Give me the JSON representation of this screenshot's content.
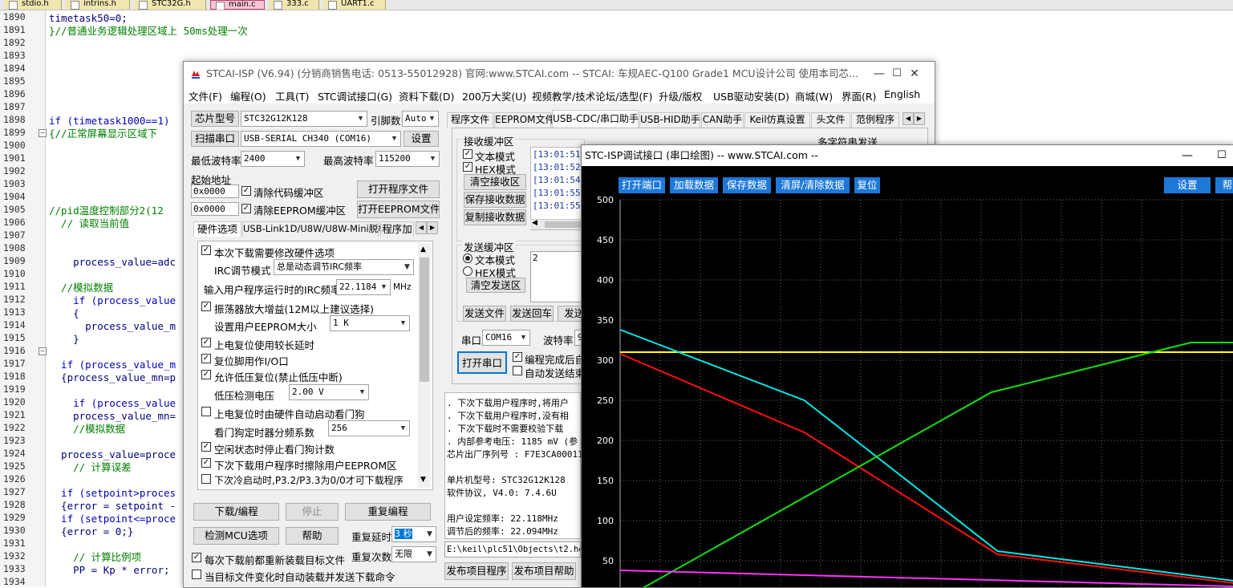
{
  "editor_tabs": [
    {
      "label": "stdio.h",
      "active": false
    },
    {
      "label": "intrins.h",
      "active": false
    },
    {
      "label": "STC32G.h",
      "active": false
    },
    {
      "label": "main.c",
      "active": true
    },
    {
      "label": "333.c",
      "active": false
    },
    {
      "label": "UART1.c",
      "active": false
    }
  ],
  "code": {
    "line_numbers": [
      "1890",
      "1891",
      "1892",
      "1893",
      "1894",
      "1895",
      "1896",
      "1897",
      "1898",
      "1899",
      "1900",
      "1901",
      "1902",
      "1903",
      "1904",
      "1905",
      "1906",
      "1907",
      "1908",
      "1909",
      "1910",
      "1911",
      "1912",
      "1913",
      "1914",
      "1915",
      "1916",
      "1917",
      "1918",
      "1919",
      "1920",
      "1921",
      "1922",
      "1923",
      "1924",
      "1925",
      "1926",
      "1927",
      "1928",
      "1929",
      "1930",
      "1931",
      "1932",
      "1933",
      "1934"
    ],
    "lines": [
      {
        "text": "timetask50=0;",
        "style": "code"
      },
      {
        "text": "}//普通业务逻辑处理区域上 50ms处理一次",
        "style": "comment"
      },
      {
        "text": "",
        "style": "code"
      },
      {
        "text": "",
        "style": "code"
      },
      {
        "text": "",
        "style": "code"
      },
      {
        "text": "",
        "style": "code"
      },
      {
        "text": "",
        "style": "code"
      },
      {
        "text": "",
        "style": "code"
      },
      {
        "text": "if (timetask1000==1)",
        "style": "keyword"
      },
      {
        "text": "{//正常屏幕显示区域下",
        "style": "comment"
      },
      {
        "text": "",
        "style": "code"
      },
      {
        "text": "",
        "style": "code"
      },
      {
        "text": "",
        "style": "code"
      },
      {
        "text": "",
        "style": "code"
      },
      {
        "text": "",
        "style": "code"
      },
      {
        "text": "//pid温度控制部分2(12",
        "style": "comment"
      },
      {
        "text": "  // 读取当前值",
        "style": "comment"
      },
      {
        "text": "",
        "style": "code"
      },
      {
        "text": "",
        "style": "code"
      },
      {
        "text": "    process_value=adc",
        "style": "code"
      },
      {
        "text": "",
        "style": "code"
      },
      {
        "text": "  //模拟数据",
        "style": "comment"
      },
      {
        "text": "    if (process_value",
        "style": "keyword"
      },
      {
        "text": "    {",
        "style": "code"
      },
      {
        "text": "      process_value_m",
        "style": "code"
      },
      {
        "text": "    }",
        "style": "code"
      },
      {
        "text": "",
        "style": "code"
      },
      {
        "text": "  if (process_value_m",
        "style": "keyword"
      },
      {
        "text": "  {process_value_mn=p",
        "style": "code"
      },
      {
        "text": "",
        "style": "code"
      },
      {
        "text": "    if (process_value",
        "style": "keyword"
      },
      {
        "text": "    process_value_mn=",
        "style": "code"
      },
      {
        "text": "    //模拟数据",
        "style": "comment"
      },
      {
        "text": "",
        "style": "code"
      },
      {
        "text": "  process_value=proce",
        "style": "code"
      },
      {
        "text": "    // 计算误差",
        "style": "comment"
      },
      {
        "text": "",
        "style": "code"
      },
      {
        "text": "  if (setpoint>proces",
        "style": "keyword"
      },
      {
        "text": "  {error = setpoint -",
        "style": "code"
      },
      {
        "text": "  if (setpoint<=proce",
        "style": "keyword"
      },
      {
        "text": "  {error = 0;}",
        "style": "code"
      },
      {
        "text": "",
        "style": "code"
      },
      {
        "text": "    // 计算比例项",
        "style": "comment"
      },
      {
        "text": "    PP = Kp * error;",
        "style": "code"
      },
      {
        "text": "",
        "style": "code"
      }
    ]
  },
  "isp": {
    "title": "STCAI-ISP (V6.94) (分销商销售电话: 0513-55012928) 官网:www.STCAI.com  -- STCAI: 车规AEC-Q100 Grade1 MCU设计公司 使用本司芯...",
    "window_controls": {
      "minimize": "—",
      "maximize": "☐",
      "close": "✕"
    },
    "menu": [
      "文件(F)",
      "编程(O)",
      "工具(T)",
      "STC调试接口(G)",
      "资料下载(D)",
      "200万大奖(U)",
      "视频教学/技术论坛/选型(F)",
      "升级/版权",
      "USB驱动安装(D)",
      "商城(W)",
      "界面(R)",
      "English"
    ],
    "left": {
      "chip_type_btn": "芯片型号",
      "chip_type": "STC32G12K128",
      "pin_count_label": "引脚数",
      "pin_count": "Auto",
      "scan_port_btn": "扫描串口",
      "port": "USB-SERIAL CH340 (COM16)",
      "settings_btn": "设置",
      "min_baud_label": "最低波特率",
      "min_baud": "2400",
      "max_baud_label": "最高波特率",
      "max_baud": "115200",
      "start_addr_label": "起始地址",
      "addr1": "0x0000",
      "clear_code_buf": "清除代码缓冲区",
      "open_prog_file": "打开程序文件",
      "addr2": "0x0000",
      "clear_eeprom_buf": "清除EEPROM缓冲区",
      "open_eeprom_file": "打开EEPROM文件",
      "tabs": [
        "硬件选项",
        "USB-Link1D/U8W/U8W-Mini脱机",
        "程序加"
      ],
      "options": {
        "modify_hw": "本次下载需要修改硬件选项",
        "irc_mode_label": "IRC调节模式",
        "irc_mode": "总是动态调节IRC频率",
        "irc_freq_label": "输入用户程序运行时的IRC频率",
        "irc_freq": "22.1184",
        "irc_unit": "MHz",
        "osc_gain": "振荡器放大增益(12M以上建议选择)",
        "eeprom_size_label": "设置用户EEPROM大小",
        "eeprom_size": "1    K",
        "power_on_delay": "上电复位使用较长延时",
        "reset_pin_io": "复位脚用作I/O口",
        "lvr_enable": "允许低压复位(禁止低压中断)",
        "lv_detect_label": "低压检测电压",
        "lv_detect": "2.00 V",
        "wdt_auto": "上电复位时由硬件自动启动看门狗",
        "wdt_prescale_label": "看门狗定时器分频系数",
        "wdt_prescale": "256",
        "idle_stop_wdt": "空闲状态时停止看门狗计数",
        "erase_eeprom": "下次下载用户程序时擦除用户EEPROM区",
        "cold_boot": "下次冷启动时,P3.2/P3.3为0/0才可下载程序"
      },
      "download_btn": "下载/编程",
      "stop_btn": "停止",
      "reprogram_btn": "重复编程",
      "check_mcu_btn": "检测MCU选项",
      "help_btn": "帮助",
      "repeat_delay_label": "重复延时",
      "repeat_delay": "3 秒",
      "repeat_count_label": "重复次数",
      "repeat_count": "无限",
      "reload_each": "每次下载前都重新装载目标文件",
      "auto_load": "当目标文件变化时自动装载并发送下载命令"
    },
    "right": {
      "tabs": [
        "程序文件",
        "EEPROM文件",
        "USB-CDC/串口助手",
        "USB-HID助手",
        "CAN助手",
        "Keil仿真设置",
        "头文件",
        "范例程序"
      ],
      "recv_group": "接收缓冲区",
      "multi_send": "多字符串发送",
      "text_mode": "文本模式",
      "hex_mode": "HEX模式",
      "clear_recv": "清空接收区",
      "save_recv": "保存接收数据",
      "copy_recv": "复制接收数据",
      "recv_lines": [
        "[13:01:51.9",
        "[13:01:52.9",
        "[13:01:54.0",
        "[13:01:55.0",
        "[13:01:55.9"
      ],
      "send_group": "发送缓冲区",
      "send_text_mode": "文本模式",
      "send_hex_mode": "HEX模式",
      "clear_send": "清空发送区",
      "send_value": "2",
      "send_file": "发送文件",
      "send_return": "发送回车",
      "send_data": "发送数",
      "port_label": "串口",
      "port_value": "COM16",
      "baud_label": "波特率",
      "baud_value": "9",
      "open_port": "打开串口",
      "auto_open": "编程完成后自",
      "auto_send_end": "自动发送结束",
      "log": [
        ". 下次下载用户程序时,将用户",
        ". 下次下载用户程序时,没有相",
        ". 下次下载时不需要校验下载",
        ". 内部参考电压: 1185 mV (参",
        "芯片出厂序列号 : F7E3CA00011",
        "",
        "  单片机型号: STC32G12K128",
        "  软件协议, V4.0: 7.4.6U",
        "",
        "  用户设定频率: 22.118MHz",
        "  调节后的频率: 22.094MHz"
      ],
      "file_path": "E:\\keil\\plc51\\Objects\\t2.hex",
      "publish_prog": "发布项目程序",
      "publish_help": "发布项目帮助"
    }
  },
  "plot": {
    "title": "STC-ISP调试接口 (串口绘图) -- www.STCAI.com --",
    "buttons": [
      "打开端口",
      "加载数据",
      "保存数据",
      "清屏/清除数据",
      "复位"
    ],
    "settings_btn": "设置",
    "chart_data": {
      "type": "line",
      "title": "",
      "xlabel": "",
      "ylabel": "",
      "yticks": [
        500,
        450,
        400,
        350,
        300,
        250,
        200,
        150,
        100,
        50
      ],
      "ylim": [
        0,
        500
      ],
      "xlim": [
        0,
        100
      ],
      "grid": true,
      "series": [
        {
          "color": "#ffff00",
          "x": [
            0,
            100
          ],
          "y": [
            310,
            310
          ]
        },
        {
          "color": "#00e8e8",
          "x": [
            0,
            30,
            61.5,
            100
          ],
          "y": [
            338,
            250,
            62,
            25
          ]
        },
        {
          "color": "#ff1010",
          "x": [
            0,
            30,
            61.5,
            100
          ],
          "y": [
            308,
            210,
            58,
            22
          ]
        },
        {
          "color": "#10e010",
          "x": [
            0,
            60.5,
            93,
            100
          ],
          "y": [
            0,
            260,
            322,
            322
          ]
        },
        {
          "color": "#ff30ff",
          "x": [
            0,
            100
          ],
          "y": [
            38,
            18
          ]
        }
      ]
    }
  },
  "colors": {
    "accent": "#1e78d8",
    "plot_bg": "#000000",
    "grid": "#6e6e6e"
  }
}
